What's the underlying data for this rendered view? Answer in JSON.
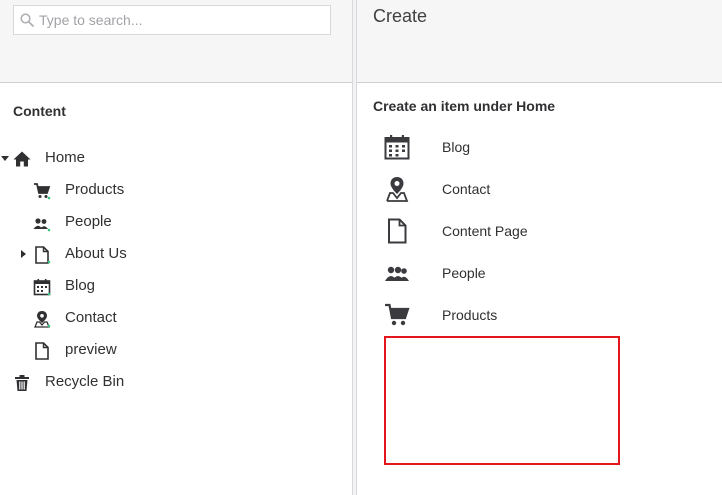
{
  "search": {
    "placeholder": "Type to search..."
  },
  "tree": {
    "section_title": "Content",
    "items": [
      {
        "label": "Home",
        "icon": "home-icon"
      },
      {
        "label": "Products",
        "icon": "shopping-cart-icon"
      },
      {
        "label": "People",
        "icon": "people-icon"
      },
      {
        "label": "About Us",
        "icon": "document-icon"
      },
      {
        "label": "Blog",
        "icon": "calendar-icon"
      },
      {
        "label": "Contact",
        "icon": "map-pin-icon"
      },
      {
        "label": "preview",
        "icon": "document-icon"
      },
      {
        "label": "Recycle Bin",
        "icon": "trash-icon"
      }
    ]
  },
  "editor": {
    "title": "Create",
    "heading": "Create an item under Home",
    "content_types": [
      {
        "label": "Blog",
        "icon": "calendar-icon"
      },
      {
        "label": "Contact",
        "icon": "map-pin-icon"
      },
      {
        "label": "Content Page",
        "icon": "document-icon"
      },
      {
        "label": "People",
        "icon": "people-icon"
      },
      {
        "label": "Products",
        "icon": "shopping-cart-icon"
      }
    ]
  },
  "colors": {
    "text": "#303033",
    "icon": "#3b3b3f",
    "accent_teal": "#35c786",
    "highlight": "#e3161b"
  }
}
